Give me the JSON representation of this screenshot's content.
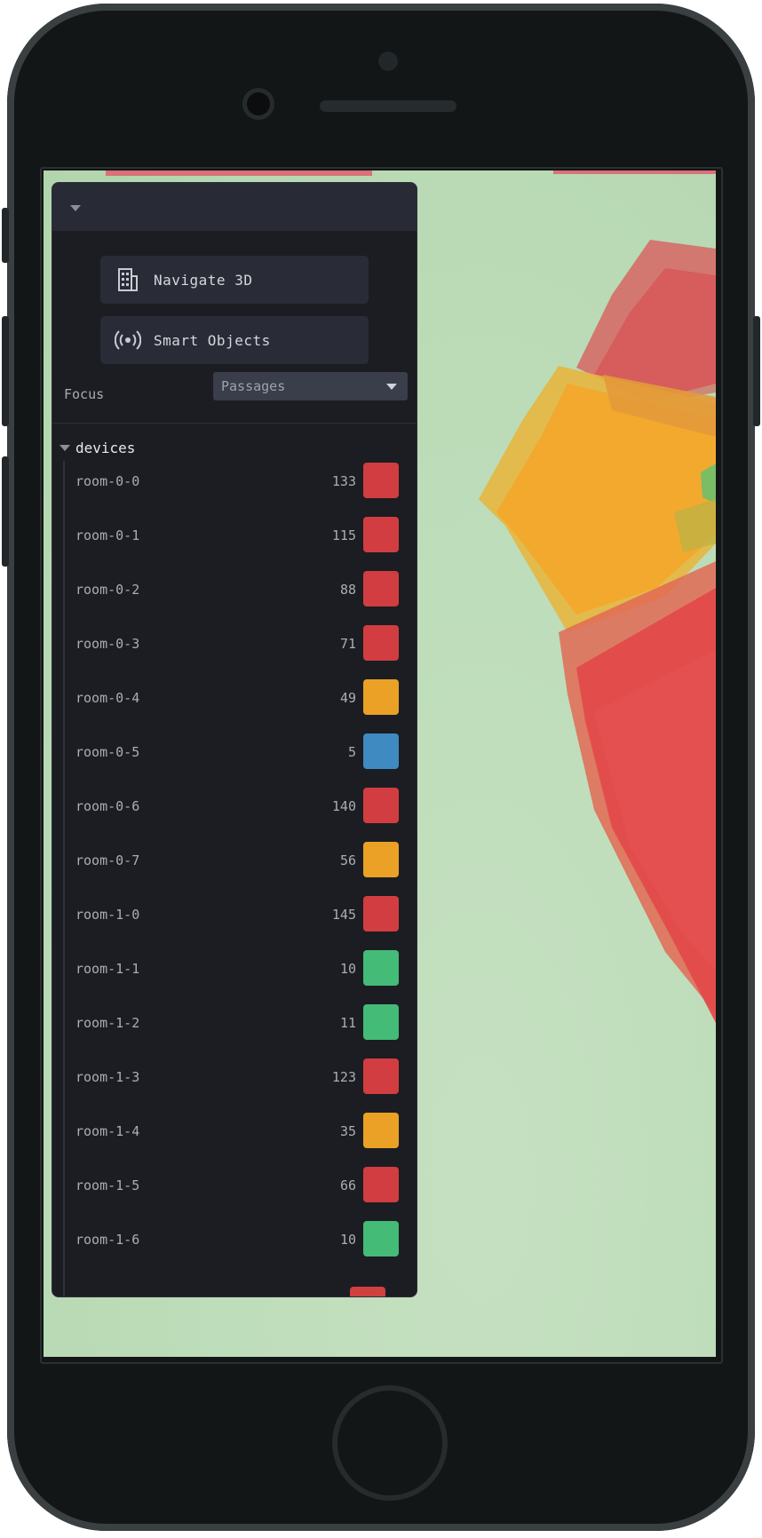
{
  "toolbar": {
    "navigate_label": "Navigate 3D",
    "navigate_icon": "building-icon",
    "smart_label": "Smart Objects",
    "smart_icon": "broadcast-icon"
  },
  "focus": {
    "label": "Focus",
    "selected": "Passages"
  },
  "devices": {
    "title": "devices",
    "items": [
      {
        "name": "room-0-0",
        "value": "133",
        "color": "#d13d40"
      },
      {
        "name": "room-0-1",
        "value": "115",
        "color": "#d13d40"
      },
      {
        "name": "room-0-2",
        "value": "88",
        "color": "#d13d40"
      },
      {
        "name": "room-0-3",
        "value": "71",
        "color": "#d13d40"
      },
      {
        "name": "room-0-4",
        "value": "49",
        "color": "#eba126"
      },
      {
        "name": "room-0-5",
        "value": "5",
        "color": "#3f8ac0"
      },
      {
        "name": "room-0-6",
        "value": "140",
        "color": "#d13d40"
      },
      {
        "name": "room-0-7",
        "value": "56",
        "color": "#eba126"
      },
      {
        "name": "room-1-0",
        "value": "145",
        "color": "#d13d40"
      },
      {
        "name": "room-1-1",
        "value": "10",
        "color": "#45bb78"
      },
      {
        "name": "room-1-2",
        "value": "11",
        "color": "#45bb78"
      },
      {
        "name": "room-1-3",
        "value": "123",
        "color": "#d13d40"
      },
      {
        "name": "room-1-4",
        "value": "35",
        "color": "#eba126"
      },
      {
        "name": "room-1-5",
        "value": "66",
        "color": "#d13d40"
      },
      {
        "name": "room-1-6",
        "value": "10",
        "color": "#45bb78"
      }
    ]
  }
}
